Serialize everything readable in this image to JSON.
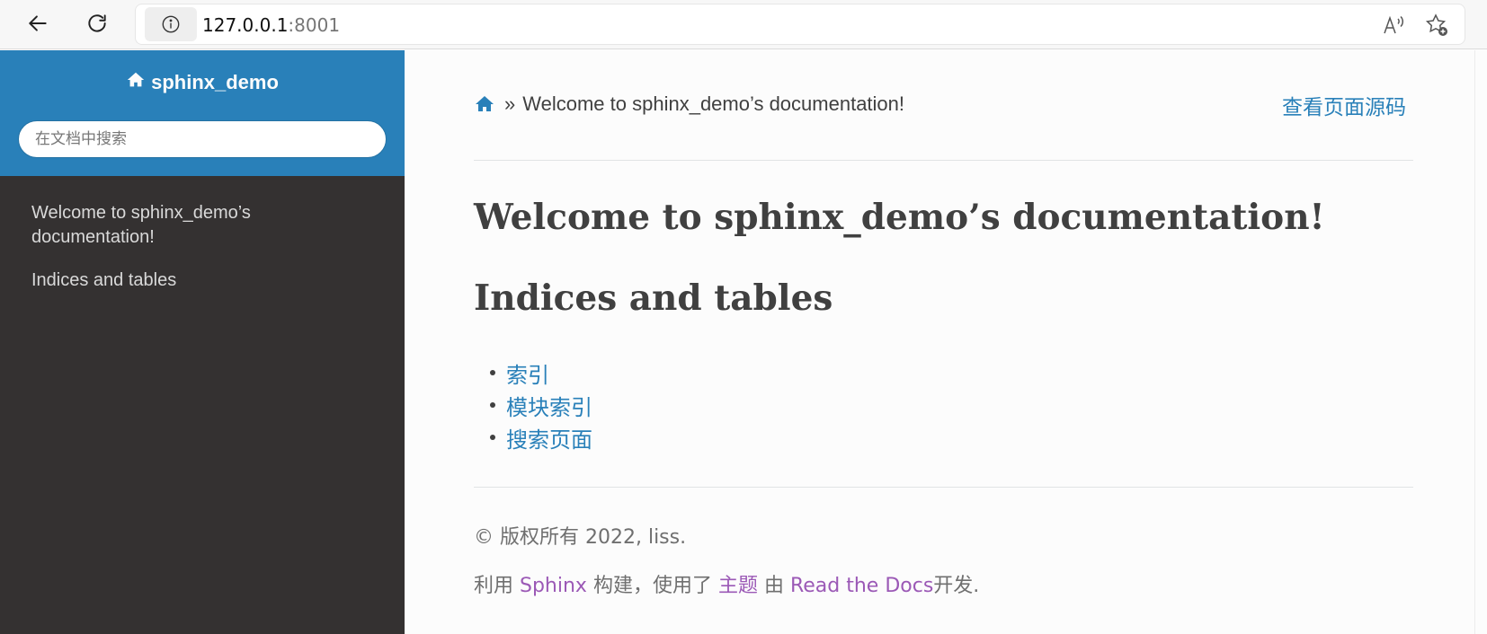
{
  "browser": {
    "url_host": "127.0.0.1",
    "url_port": ":8001",
    "icons": [
      "back-arrow-icon",
      "reload-icon",
      "info-icon",
      "read-aloud-icon",
      "favorite-star-icon"
    ]
  },
  "sidebar": {
    "project_name": "sphinx_demo",
    "search_placeholder": "在文档中搜索",
    "toc": [
      {
        "label": "Welcome to sphinx_demo’s documentation!"
      },
      {
        "label": "Indices and tables"
      }
    ],
    "colors": {
      "header_bg": "#2980b9",
      "body_bg": "#343131",
      "toc_text": "#d9d9d9"
    }
  },
  "breadcrumb": {
    "separator": "»",
    "current": "Welcome to sphinx_demo’s documentation!"
  },
  "view_source_label": "查看页面源码",
  "main": {
    "title": "Welcome to sphinx_demo’s documentation!",
    "section_title": "Indices and tables",
    "links": [
      {
        "label": "索引"
      },
      {
        "label": "模块索引"
      },
      {
        "label": "搜索页面"
      }
    ],
    "link_color": "#2980b9"
  },
  "footer": {
    "copyright": "© 版权所有 2022, liss.",
    "built_prefix": "利用 ",
    "sphinx_link": "Sphinx",
    "built_mid1": " 构建，使用了 ",
    "theme_link": "主题",
    "built_mid2": " 由 ",
    "rtd_link": "Read the Docs",
    "built_suffix": "开发.",
    "link_color": "#9b59b6"
  }
}
